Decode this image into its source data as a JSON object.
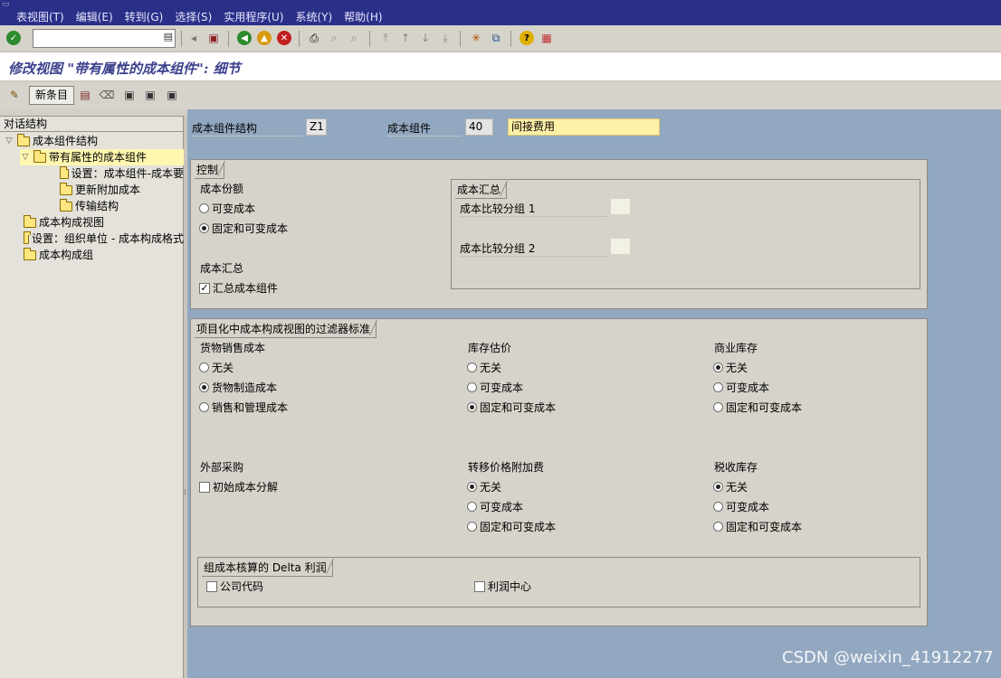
{
  "menu": [
    "表视图(T)",
    "编辑(E)",
    "转到(G)",
    "选择(S)",
    "实用程序(U)",
    "系统(Y)",
    "帮助(H)"
  ],
  "title": "修改视图 \"带有属性的成本组件\": 细节",
  "toolbar": {
    "new_entries": "新条目"
  },
  "tree": {
    "header": "对话结构",
    "nodes": [
      "成本组件结构",
      "带有属性的成本组件",
      "设置：成本组件-成本要",
      "更新附加成本",
      "传输结构",
      "成本构成视图",
      "设置：组织单位 - 成本构成格式",
      "成本构成组"
    ]
  },
  "header_fields": {
    "structure_label": "成本组件结构",
    "structure_value": "Z1",
    "component_label": "成本组件",
    "component_value": "40",
    "component_desc": "间接费用"
  },
  "control": {
    "title": "控制",
    "portion_label": "成本份额",
    "options": [
      "可变成本",
      "固定和可变成本"
    ],
    "summary_label": "成本汇总",
    "summary_check": "汇总成本组件",
    "cost_summary": {
      "title": "成本汇总",
      "group1": "成本比较分组 1",
      "group2": "成本比较分组 2"
    }
  },
  "filter": {
    "title": "项目化中成本构成视图的过滤器标准",
    "cogs": {
      "label": "货物销售成本",
      "options": [
        "无关",
        "货物制造成本",
        "销售和管理成本"
      ]
    },
    "inventory": {
      "label": "库存估价",
      "options": [
        "无关",
        "可变成本",
        "固定和可变成本"
      ]
    },
    "commercial": {
      "label": "商业库存",
      "options": [
        "无关",
        "可变成本",
        "固定和可变成本"
      ]
    },
    "external": {
      "label": "外部采购",
      "check": "初始成本分解"
    },
    "transfer": {
      "label": "转移价格附加费",
      "options": [
        "无关",
        "可变成本",
        "固定和可变成本"
      ]
    },
    "tax": {
      "label": "税收库存",
      "options": [
        "无关",
        "可变成本",
        "固定和可变成本"
      ]
    },
    "delta": {
      "title": "组成本核算的 Delta 利润",
      "company": "公司代码",
      "profit": "利润中心"
    }
  },
  "watermark": "CSDN @weixin_41912277"
}
